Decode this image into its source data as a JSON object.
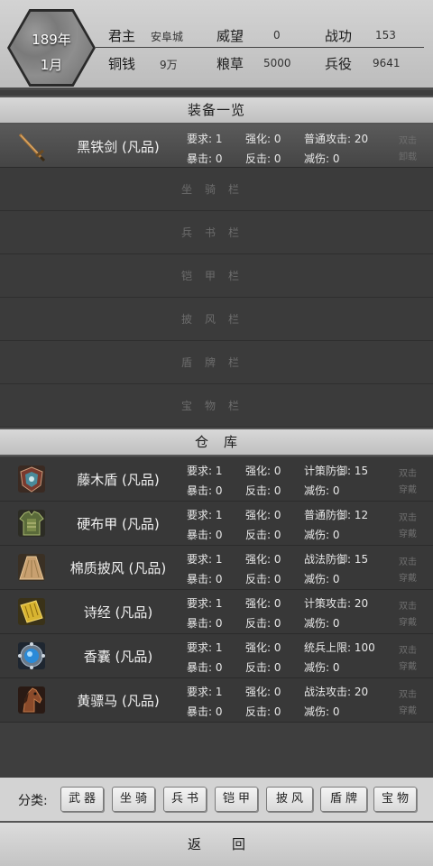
{
  "header": {
    "year": "189年",
    "month": "1月",
    "lord_label": "君主",
    "lord_value": "安阜城",
    "prestige_label": "威望",
    "prestige_value": "0",
    "merit_label": "战功",
    "merit_value": "153",
    "copper_label": "铜钱",
    "copper_value": "9万",
    "grain_label": "粮草",
    "grain_value": "5000",
    "troops_label": "兵役",
    "troops_value": "9641"
  },
  "equipped": {
    "title": "装备一览",
    "weapon": {
      "icon": "sword-icon",
      "name": "黑铁剑 (凡品)",
      "req": "要求: 1",
      "enh": "强化: 0",
      "stat": "普通攻击: 20",
      "crit": "暴击: 0",
      "counter": "反击: 0",
      "reduce": "减伤: 0",
      "hint1": "双击",
      "hint2": "卸载"
    },
    "empty_slots": [
      "坐骑栏",
      "兵书栏",
      "铠甲栏",
      "披风栏",
      "盾牌栏",
      "宝物栏"
    ]
  },
  "warehouse": {
    "title": "仓　库",
    "items": [
      {
        "icon": "shield-icon",
        "name": "藤木盾 (凡品)",
        "req": "要求: 1",
        "enh": "强化: 0",
        "stat": "计策防御: 15",
        "crit": "暴击: 0",
        "counter": "反击: 0",
        "reduce": "减伤: 0",
        "hint1": "双击",
        "hint2": "穿戴"
      },
      {
        "icon": "armor-icon",
        "name": "硬布甲 (凡品)",
        "req": "要求: 1",
        "enh": "强化: 0",
        "stat": "普通防御: 12",
        "crit": "暴击: 0",
        "counter": "反击: 0",
        "reduce": "减伤: 0",
        "hint1": "双击",
        "hint2": "穿戴"
      },
      {
        "icon": "cloak-icon",
        "name": "棉质披风 (凡品)",
        "req": "要求: 1",
        "enh": "强化: 0",
        "stat": "战法防御: 15",
        "crit": "暴击: 0",
        "counter": "反击: 0",
        "reduce": "减伤: 0",
        "hint1": "双击",
        "hint2": "穿戴"
      },
      {
        "icon": "book-scroll-icon",
        "name": "诗经 (凡品)",
        "req": "要求: 1",
        "enh": "强化: 0",
        "stat": "计策攻击: 20",
        "crit": "暴击: 0",
        "counter": "反击: 0",
        "reduce": "减伤: 0",
        "hint1": "双击",
        "hint2": "穿戴"
      },
      {
        "icon": "sachet-gem-icon",
        "name": "香囊 (凡品)",
        "req": "要求: 1",
        "enh": "强化: 0",
        "stat": "统兵上限: 100",
        "crit": "暴击: 0",
        "counter": "反击: 0",
        "reduce": "减伤: 0",
        "hint1": "双击",
        "hint2": "穿戴"
      },
      {
        "icon": "horse-icon",
        "name": "黄骠马 (凡品)",
        "req": "要求: 1",
        "enh": "强化: 0",
        "stat": "战法攻击: 20",
        "crit": "暴击: 0",
        "counter": "反击: 0",
        "reduce": "减伤: 0",
        "hint1": "双击",
        "hint2": "穿戴"
      }
    ]
  },
  "category": {
    "label": "分类:",
    "buttons": [
      "武器",
      "坐骑",
      "兵书",
      "铠甲",
      "披风",
      "盾牌",
      "宝物"
    ]
  },
  "back_label": "返回"
}
